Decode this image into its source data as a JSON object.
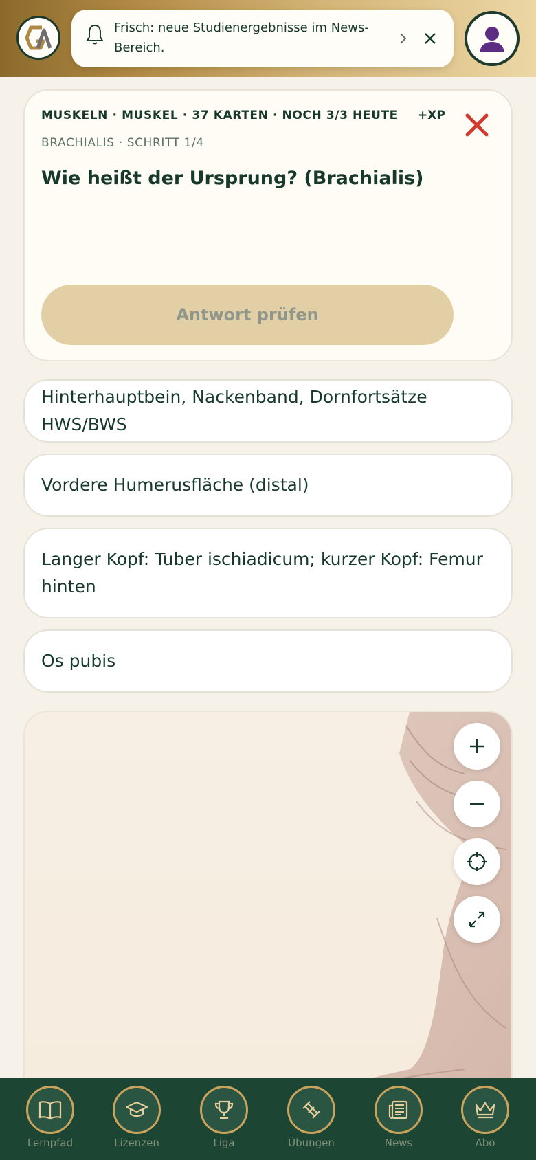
{
  "header": {
    "notification": {
      "text": "Frisch: neue Studienergebnisse im News-Bereich.",
      "icon": "bell-icon"
    },
    "colors": {
      "brand_dark": "#1d4534",
      "gold": "#c9a35c"
    }
  },
  "card": {
    "meta": "MUSKELN · MUSKEL · 37 KARTEN · NOCH 3/3 HEUTE",
    "xp": "+XP",
    "step": "BRACHIALIS · SCHRITT 1/4",
    "question": "Wie heißt der Ursprung? (Brachialis)",
    "check_label": "Antwort prüfen"
  },
  "answers": [
    "Hinterhauptbein, Nackenband, Dornfortsätze HWS/BWS",
    "Vordere Humerusfläche (distal)",
    "Langer Kopf: Tuber ischiadicum; kurzer Kopf: Femur hinten",
    "Os pubis"
  ],
  "viewer": {
    "controls": [
      "plus-icon",
      "minus-icon",
      "crosshair-icon",
      "expand-icon"
    ]
  },
  "nav": [
    {
      "label": "Lernpfad",
      "icon": "book-icon"
    },
    {
      "label": "Lizenzen",
      "icon": "graduation-cap-icon"
    },
    {
      "label": "Liga",
      "icon": "trophy-icon"
    },
    {
      "label": "Übungen",
      "icon": "dumbbell-icon"
    },
    {
      "label": "News",
      "icon": "newspaper-icon"
    },
    {
      "label": "Abo",
      "icon": "crown-icon"
    }
  ]
}
